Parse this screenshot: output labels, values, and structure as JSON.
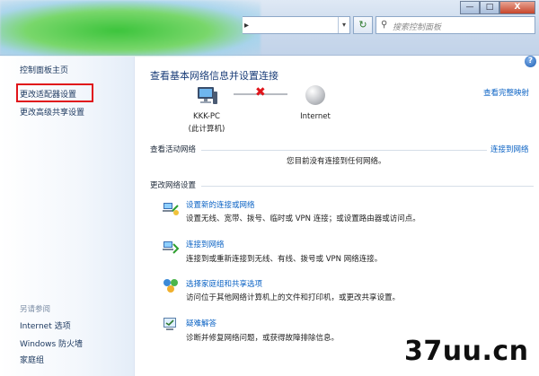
{
  "search": {
    "placeholder": "搜索控制面板"
  },
  "window": {
    "minimize": "—",
    "maximize": "□",
    "close": "X"
  },
  "sidebar": {
    "items": [
      {
        "label": "控制面板主页"
      },
      {
        "label": "更改适配器设置"
      },
      {
        "label": "更改高级共享设置"
      }
    ],
    "see_also_label": "另请参阅",
    "see_also": [
      {
        "label": "Internet 选项"
      },
      {
        "label": "Windows 防火墙"
      },
      {
        "label": "家庭组"
      }
    ]
  },
  "main": {
    "title": "查看基本网络信息并设置连接",
    "full_map_link": "查看完整映射",
    "nodes": {
      "pc_name": "KKK-PC",
      "pc_sub": "(此计算机)",
      "internet": "Internet"
    },
    "active_networks": {
      "heading": "查看活动网络",
      "connect_link": "连接到网络",
      "status": "您目前没有连接到任何网络。"
    },
    "change_settings": {
      "heading": "更改网络设置",
      "tasks": [
        {
          "title": "设置新的连接或网络",
          "desc": "设置无线、宽带、拨号、临时或 VPN 连接；或设置路由器或访问点。",
          "icon": "new-connection-icon"
        },
        {
          "title": "连接到网络",
          "desc": "连接到或重新连接到无线、有线、拨号或 VPN 网络连接。",
          "icon": "connect-network-icon"
        },
        {
          "title": "选择家庭组和共享选项",
          "desc": "访问位于其他网络计算机上的文件和打印机，或更改共享设置。",
          "icon": "homegroup-icon"
        },
        {
          "title": "疑难解答",
          "desc": "诊断并修复网络问题，或获得故障排除信息。",
          "icon": "troubleshoot-icon"
        }
      ]
    }
  },
  "watermark": "37uu.cn",
  "colors": {
    "link": "#0a62c4",
    "highlight_box": "#e0141a",
    "disconnect_x": "#e0141a"
  }
}
